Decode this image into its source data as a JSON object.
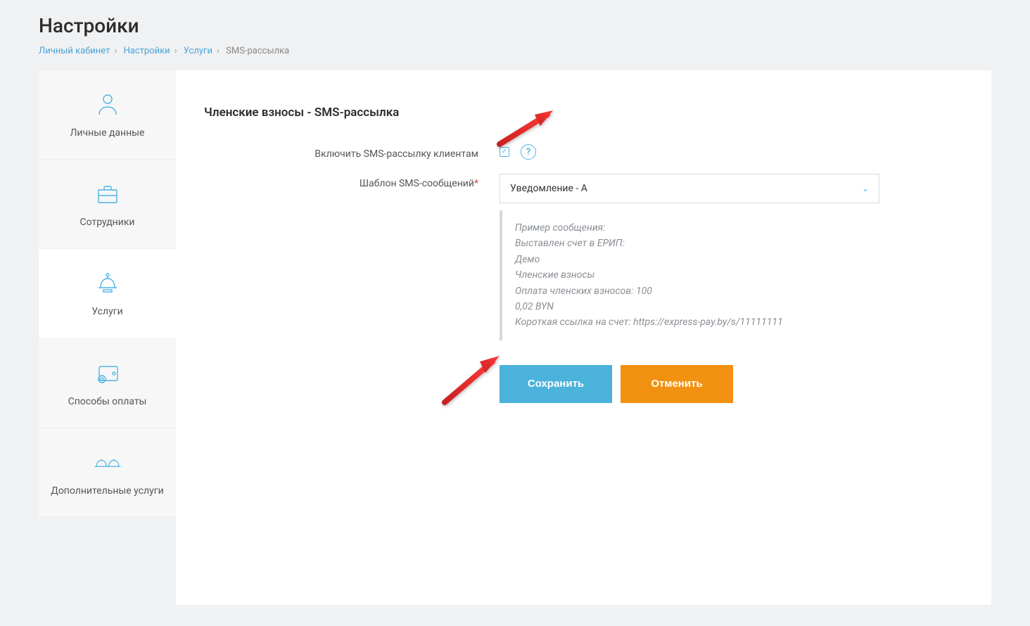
{
  "page": {
    "title": "Настройки"
  },
  "breadcrumb": {
    "items": [
      "Личный кабинет",
      "Настройки",
      "Услуги"
    ],
    "current": "SMS-рассылка"
  },
  "sidebar": {
    "items": [
      {
        "label": "Личные данные"
      },
      {
        "label": "Сотрудники"
      },
      {
        "label": "Услуги"
      },
      {
        "label": "Способы оплаты"
      },
      {
        "label": "Дополнительные услуги"
      }
    ]
  },
  "form": {
    "section_title": "Членские взносы - SMS-рассылка",
    "enable_label": "Включить SMS-рассылку клиентам",
    "template_label": "Шаблон SMS-сообщений",
    "template_selected": "Уведомление - А",
    "example": {
      "line1": "Пример сообщения:",
      "line2": "Выставлен счет в ЕРИП:",
      "line3": "Демо",
      "line4": "Членские взносы",
      "line5": "Оплата членских взносов: 100",
      "line6": "0,02 BYN",
      "line7": "Короткая ссылка на счет: https://express-pay.by/s/11111111"
    },
    "save_label": "Сохранить",
    "cancel_label": "Отменить"
  }
}
